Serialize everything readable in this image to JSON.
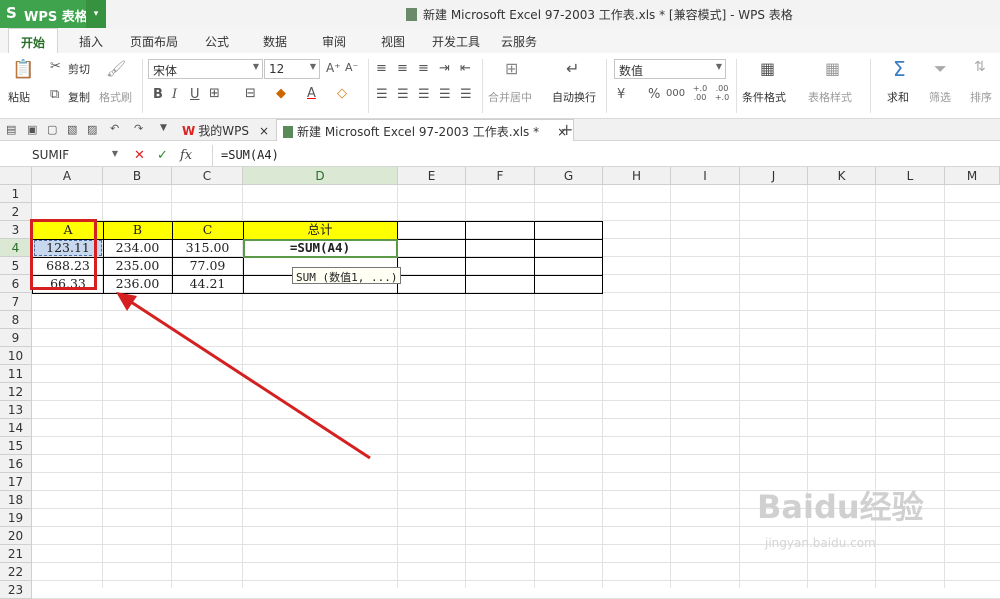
{
  "app": {
    "logo": "S",
    "name": "WPS 表格",
    "dropdown": "▾"
  },
  "window_title": "新建 Microsoft Excel 97-2003 工作表.xls * [兼容模式] - WPS 表格",
  "menu": [
    "开始",
    "插入",
    "页面布局",
    "公式",
    "数据",
    "审阅",
    "视图",
    "开发工具",
    "云服务"
  ],
  "ribbon": {
    "paste": "粘贴",
    "cut": "剪切",
    "copy": "复制",
    "format_painter": "格式刷",
    "font_name": "宋体",
    "font_size": "12",
    "number_format": "数值",
    "merge_center": "合并居中",
    "wrap_text": "自动换行",
    "conditional_format": "条件格式",
    "table_style": "表格样式",
    "sum": "求和",
    "filter": "筛选",
    "sort": "排序",
    "bold": "B",
    "italic": "I",
    "underline": "U",
    "percent": "%",
    "thousands": "000",
    "inc_decimal": "+.0 .00",
    "dec_decimal": ".00 +.0"
  },
  "tabs": {
    "home": "我的WPS",
    "doc": "新建 Microsoft Excel 97-2003 工作表.xls *",
    "close": "×",
    "add": "+"
  },
  "formula_bar": {
    "name_box": "SUMIF",
    "cancel": "✕",
    "confirm": "✓",
    "fx": "fx",
    "content": "=SUM(A4)"
  },
  "columns": [
    "A",
    "B",
    "C",
    "D",
    "E",
    "F",
    "G",
    "H",
    "I",
    "J",
    "K",
    "L",
    "M"
  ],
  "rows": [
    "1",
    "2",
    "3",
    "4",
    "5",
    "6",
    "7",
    "8",
    "9",
    "10",
    "11",
    "12",
    "13",
    "14",
    "15",
    "16",
    "17",
    "18",
    "19",
    "20",
    "21",
    "22",
    "23"
  ],
  "sheet": {
    "header": {
      "A": "A",
      "B": "B",
      "C": "C",
      "D": "总计"
    },
    "r4": {
      "A": "123.11",
      "B": "234.00",
      "C": "315.00",
      "D": "=SUM(A4)"
    },
    "r5": {
      "A": "688.23",
      "B": "235.00",
      "C": "77.09"
    },
    "r6": {
      "A": "66.33",
      "B": "236.00",
      "C": "44.21"
    }
  },
  "tooltip": "SUM (数值1, ...)",
  "watermark": {
    "main": "Baidu经验",
    "sub": "jingyan.baidu.com"
  },
  "colors": {
    "accent": "#3fa34d",
    "highlight": "#ffff00",
    "annotation": "#d42020"
  }
}
